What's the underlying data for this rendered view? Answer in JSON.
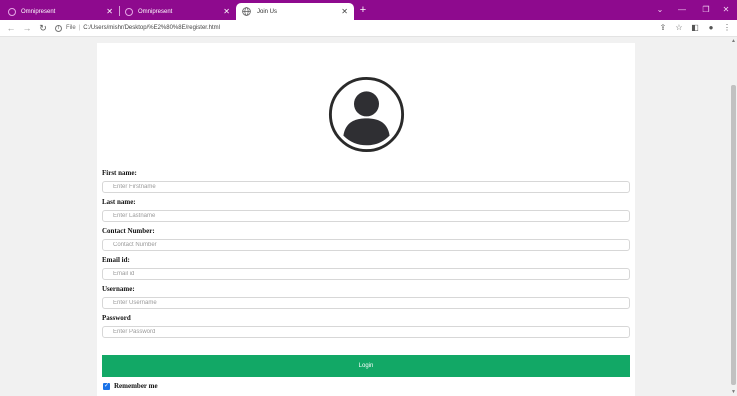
{
  "browser": {
    "tabs": [
      {
        "title": "Omnipresent",
        "active": false
      },
      {
        "title": "Omnipresent",
        "active": false
      },
      {
        "title": "Join Us",
        "active": true
      }
    ],
    "new_tab_icon": "plus-icon",
    "address": {
      "scheme": "File",
      "url": "C:/Users/mishr/Desktop/%E2%80%8E/register.html"
    },
    "accent_color": "#8e0a8e"
  },
  "form": {
    "avatar_icon": "user-avatar-icon",
    "fields": [
      {
        "label": "First name:",
        "placeholder": "Enter Firstname"
      },
      {
        "label": "Last name:",
        "placeholder": "Enter Lastname"
      },
      {
        "label": "Contact Number:",
        "placeholder": "Contact Number"
      },
      {
        "label": "Email id:",
        "placeholder": "Email id"
      },
      {
        "label": "Username:",
        "placeholder": "Enter Username"
      },
      {
        "label": "Password",
        "placeholder": "Enter Password"
      }
    ],
    "login_label": "Login",
    "login_color": "#12a866",
    "remember_label": "Remember me",
    "remember_checked": true
  }
}
